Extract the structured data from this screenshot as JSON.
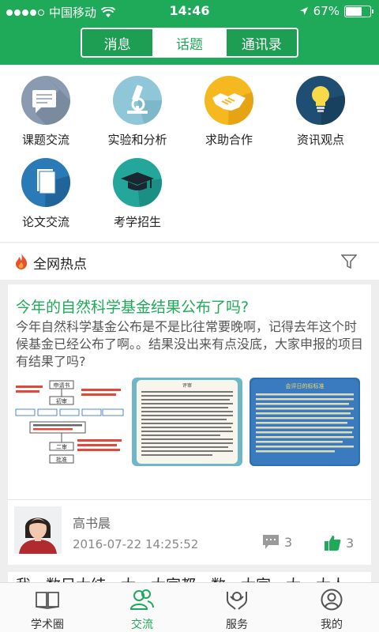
{
  "status_bar": {
    "carrier": "中国移动",
    "time": "14:46",
    "battery": "67%",
    "battery_level": 0.67
  },
  "segmented": {
    "tabs": [
      {
        "label": "消息",
        "active": false
      },
      {
        "label": "话题",
        "active": true
      },
      {
        "label": "通讯录",
        "active": false
      }
    ]
  },
  "categories": [
    {
      "label": "课题交流",
      "icon": "chat-bubble-icon",
      "color": "#8a9ab0"
    },
    {
      "label": "实验和分析",
      "icon": "microscope-icon",
      "color": "#8fc6d8"
    },
    {
      "label": "求助合作",
      "icon": "handshake-icon",
      "color": "#f5b81f"
    },
    {
      "label": "资讯观点",
      "icon": "lightbulb-icon",
      "color": "#1e4e73"
    },
    {
      "label": "论文交流",
      "icon": "document-icon",
      "color": "#2b7ab8"
    },
    {
      "label": "考学招生",
      "icon": "graduation-cap-icon",
      "color": "#23a79a"
    }
  ],
  "hot": {
    "title": "全网热点"
  },
  "post": {
    "title": "今年的自然科学基金结果公布了吗?",
    "body": "今年自然科学基金公布是不是比往常要晚啊，记得去年这个时候基金已经公布了啊。。结果没出来有点没底，大家申报的项目有结果了吗?",
    "images": [
      "flowchart-image",
      "article-text-image",
      "evaluation-criteria-image"
    ],
    "image_flow_labels": [
      "申请书",
      "初审",
      "二审",
      "批准"
    ],
    "image_doc_title": "评审",
    "image_criteria_title": "会评日的标标准",
    "author": "高书晨",
    "timestamp": "2016-07-22 14:25:52",
    "comments": "3",
    "likes": "3"
  },
  "next_post_peek": "我…数目大结…大…大家都…数…大家…大…大人家…",
  "tabbar": {
    "items": [
      {
        "label": "学术圈",
        "icon": "book-icon",
        "active": false
      },
      {
        "label": "交流",
        "icon": "people-icon",
        "active": true
      },
      {
        "label": "服务",
        "icon": "hands-icon",
        "active": false
      },
      {
        "label": "我的",
        "icon": "person-icon",
        "active": false
      }
    ]
  },
  "colors": {
    "brand": "#1faa59",
    "title_green": "#1faa59"
  }
}
